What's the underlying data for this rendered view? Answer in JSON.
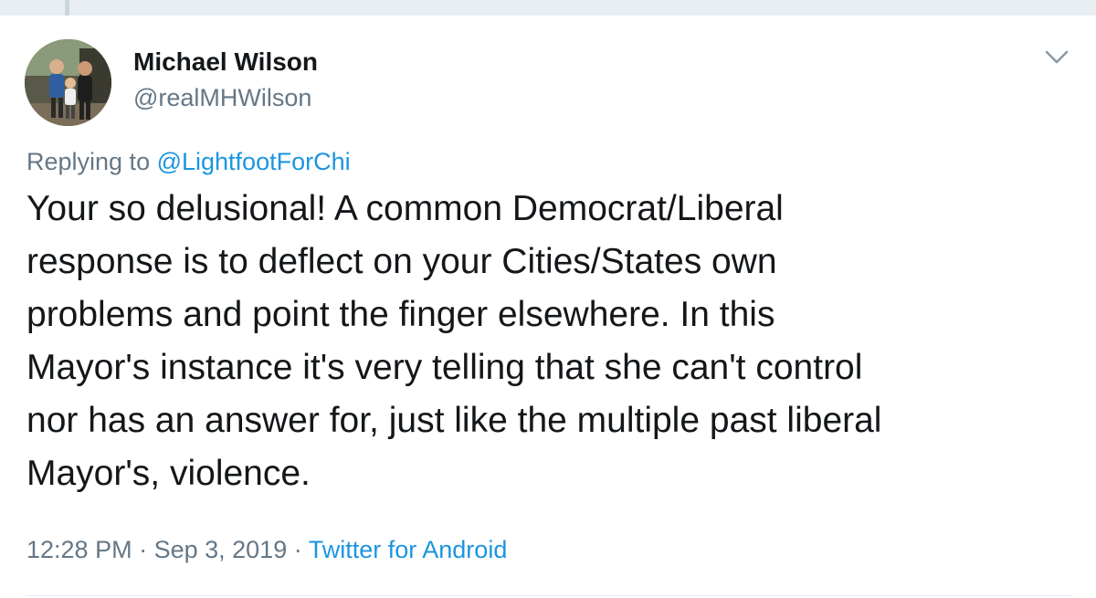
{
  "tweet": {
    "display_name": "Michael Wilson",
    "handle": "@realMHWilson",
    "replying_prefix": "Replying to ",
    "replying_to": "@LightfootForChi",
    "text_lines": [
      "Your so delusional! A common Democrat/Liberal",
      "response is to deflect on your Cities/States own",
      "problems and point the finger elsewhere. In this",
      "Mayor's instance it's very telling that she can't control",
      "nor has an answer for, just like the multiple past liberal",
      "Mayor's, violence."
    ],
    "time": "12:28 PM",
    "separator": " · ",
    "date": "Sep 3, 2019",
    "source": "Twitter for Android"
  },
  "icons": {
    "caret": "chevron-down-icon",
    "avatar": "profile-photo"
  },
  "colors": {
    "text_primary": "#14171a",
    "text_secondary": "#657786",
    "link": "#1b95e0",
    "background": "#ffffff",
    "top_strip": "#e9eef2"
  }
}
